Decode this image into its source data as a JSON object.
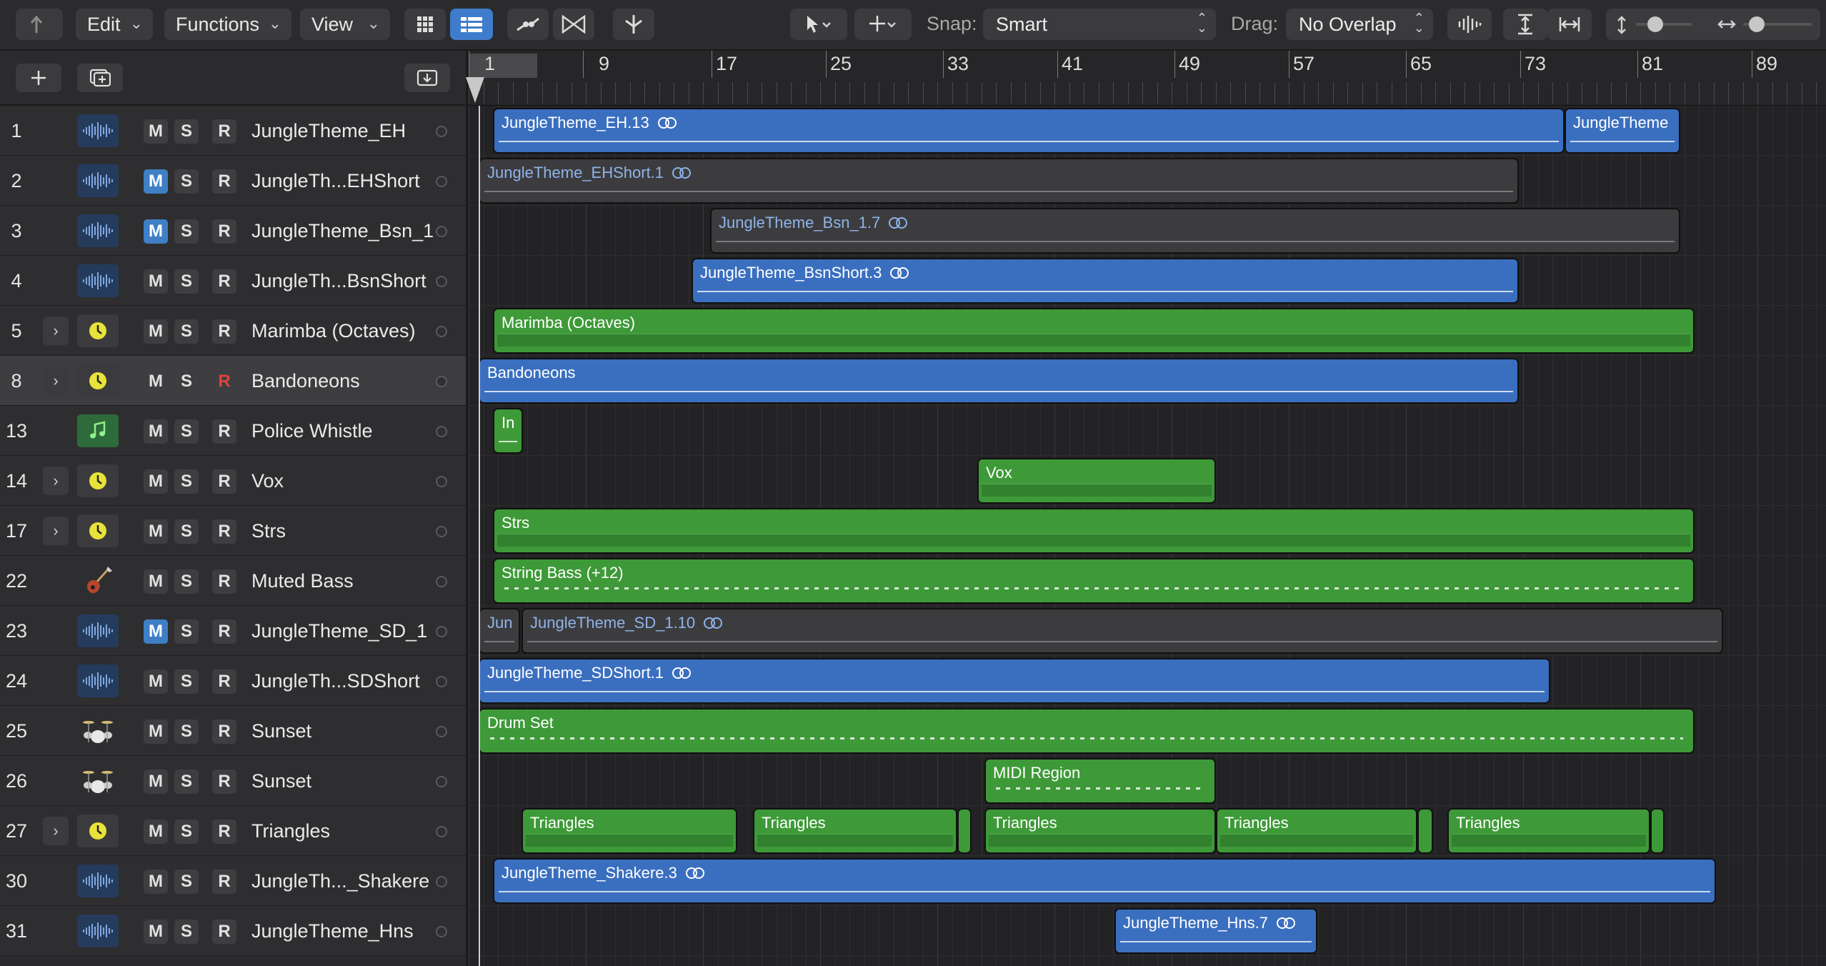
{
  "toolbar": {
    "edit": "Edit",
    "functions": "Functions",
    "view": "View",
    "snap_label": "Snap:",
    "snap_value": "Smart",
    "drag_label": "Drag:",
    "drag_value": "No Overlap"
  },
  "ruler": {
    "bars": [
      "1",
      "9",
      "17",
      "25",
      "33",
      "41",
      "49",
      "57",
      "65",
      "73",
      "81",
      "89"
    ]
  },
  "tracks": [
    {
      "num": "1",
      "name": "JungleTheme_EH",
      "icon": "audio-waveform-icon"
    },
    {
      "num": "2",
      "name": "JungleTh...EHShort",
      "icon": "audio-waveform-icon"
    },
    {
      "num": "3",
      "name": "JungleTheme_Bsn_1",
      "icon": "audio-waveform-icon"
    },
    {
      "num": "4",
      "name": "JungleTh...BsnShort",
      "icon": "audio-waveform-icon"
    },
    {
      "num": "5",
      "name": "Marimba (Octaves)",
      "icon": "sampler-icon"
    },
    {
      "num": "8",
      "name": "Bandoneons",
      "icon": "sampler-icon"
    },
    {
      "num": "13",
      "name": "Police Whistle",
      "icon": "music-note-icon"
    },
    {
      "num": "14",
      "name": "Vox",
      "icon": "sampler-icon"
    },
    {
      "num": "17",
      "name": "Strs",
      "icon": "sampler-icon"
    },
    {
      "num": "22",
      "name": "Muted Bass",
      "icon": "bass-guitar-icon"
    },
    {
      "num": "23",
      "name": "JungleTheme_SD_1",
      "icon": "audio-waveform-icon"
    },
    {
      "num": "24",
      "name": "JungleTh...SDShort",
      "icon": "audio-waveform-icon"
    },
    {
      "num": "25",
      "name": "Sunset",
      "icon": "drum-kit-icon"
    },
    {
      "num": "26",
      "name": "Sunset",
      "icon": "drum-kit-icon"
    },
    {
      "num": "27",
      "name": "Triangles",
      "icon": "sampler-icon"
    },
    {
      "num": "30",
      "name": "JungleTh..._Shakere",
      "icon": "audio-waveform-icon"
    },
    {
      "num": "31",
      "name": "JungleTheme_Hns",
      "icon": "audio-waveform-icon"
    }
  ],
  "msr": {
    "m": "M",
    "s": "S",
    "r": "R"
  },
  "regions": {
    "r1a": "JungleTheme_EH.13",
    "r1b": "JungleTheme",
    "r2": "JungleTheme_EHShort.1",
    "r3": "JungleTheme_Bsn_1.7",
    "r4": "JungleTheme_BsnShort.3",
    "r5": "Marimba (Octaves)",
    "r8": "Bandoneons",
    "r13": "In",
    "r14": "Vox",
    "r17": "Strs",
    "r22": "String Bass (+12)",
    "r23a": "Jun",
    "r23b": "JungleTheme_SD_1.10",
    "r24": "JungleTheme_SDShort.1",
    "r25": "Drum Set",
    "r26": "MIDI Region",
    "r27a": "Triangles",
    "r27b": "Triangles",
    "r27c": "Triangles",
    "r27d": "Triangles",
    "r27e": "Triangles",
    "r30": "JungleTheme_Shakere.3",
    "r31": "JungleTheme_Hns.7"
  },
  "colors": {
    "audio_region": "#3a6fc0",
    "muted_region": "#3c3c3f",
    "midi_region": "#3e9a38",
    "mute_on": "#3e7fc6",
    "record_armed": "#e0443b"
  }
}
